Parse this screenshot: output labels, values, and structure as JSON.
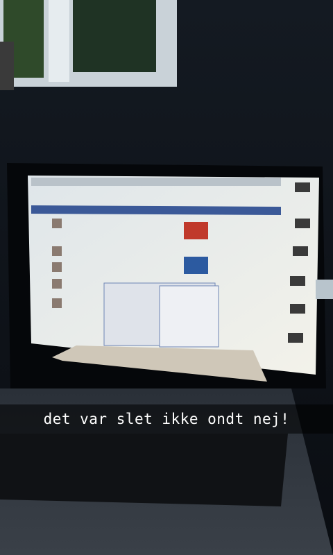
{
  "caption": {
    "text": "det var slet ikke ondt nej!"
  },
  "colors": {
    "background": "#0c0f14",
    "screen": "#e8ecef",
    "facebook_bar": "#3b5998",
    "caption_bar": "#000000"
  }
}
